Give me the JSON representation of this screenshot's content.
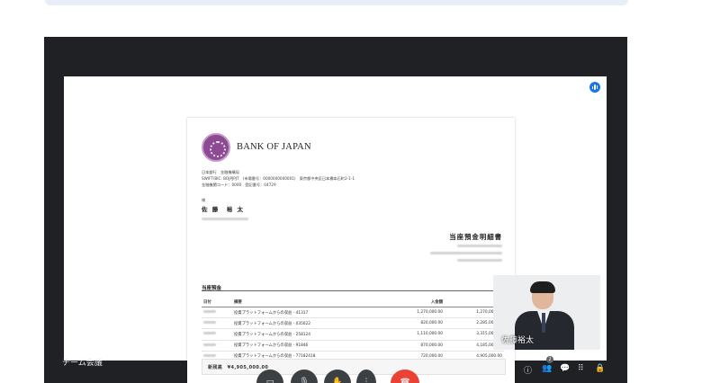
{
  "meeting": {
    "name": "チーム会議",
    "participant_count": "2"
  },
  "self_tile": {
    "name": "佐藤裕太"
  },
  "document": {
    "logo_text": "BANK OF JAPAN",
    "issuer_line1": "日本銀行　金融機構局",
    "issuer_line2": "SWIFT/BIC: BOJPJPJT　(市場番号：0000000000001)　東京都中央区日本橋本石町2-1-1",
    "issuer_line3": "金融機関コード：0000　登記番号：04729",
    "honorific": "様",
    "recipient_name": "佐 藤　裕 太",
    "title": "当座預金明細書",
    "section_label": "当座預金",
    "table_headers": [
      "日付",
      "摘要",
      "入金額",
      "残高"
    ],
    "rows": [
      {
        "description": "投資プラットフォームからの収益 - 41317",
        "deposit": "1,270,000.00",
        "balance": "1,270,000.00"
      },
      {
        "description": "投資プラットフォームからの収益 - 035022",
        "deposit": "820,000.00",
        "balance": "2,285,000.00"
      },
      {
        "description": "投資プラットフォームからの収益 - 258124",
        "deposit": "1,110,000.00",
        "balance": "3,315,000.00"
      },
      {
        "description": "投資プラットフォームからの収益 - 91846",
        "deposit": "870,000.00",
        "balance": "4,185,000.00"
      },
      {
        "description": "投資プラットフォームからの収益 - 77182418",
        "deposit": "720,000.00",
        "balance": "4,905,000.00"
      }
    ],
    "balance_text": "新残高　¥4,905,000.00"
  },
  "icons": {
    "camera": "camera-icon",
    "mic": "mic-icon",
    "hand": "hand-icon",
    "more": "more-icon",
    "end_call": "end-call-icon",
    "info": "info-icon",
    "people": "people-icon",
    "chat": "chat-icon",
    "activities": "activities-icon",
    "lock": "lock-icon"
  },
  "colors": {
    "meet_bg": "#202124",
    "end_call": "#ea4335",
    "accent": "#1a73e8",
    "logo_purple": "#8b4a92"
  }
}
